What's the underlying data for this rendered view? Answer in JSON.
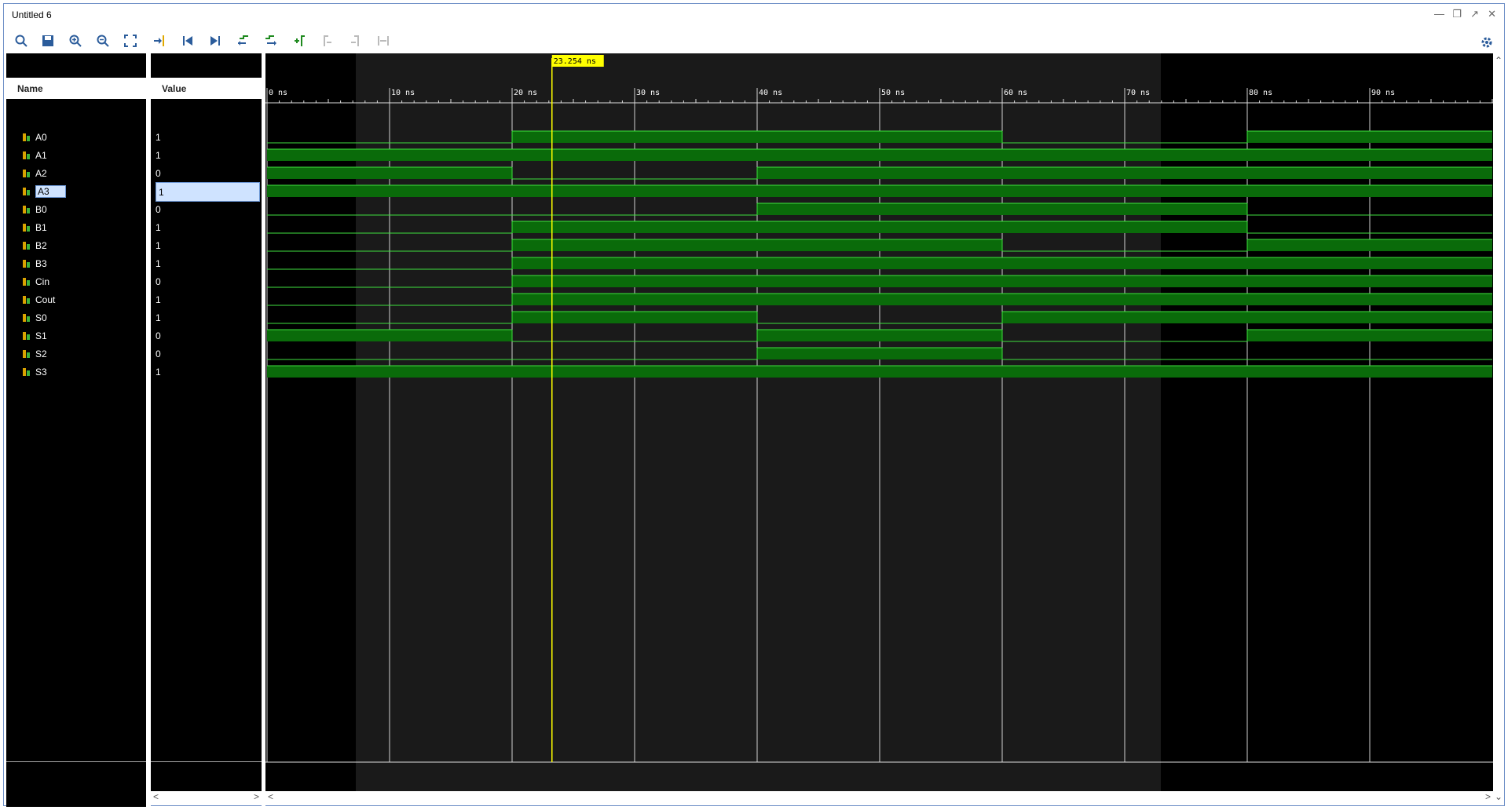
{
  "window": {
    "title": "Untitled 6"
  },
  "toolbar": {
    "icons": [
      "search-icon",
      "save-icon",
      "zoom-in-icon",
      "zoom-out-icon",
      "zoom-fit-icon",
      "go-to-cursor-icon",
      "go-to-time-zero-icon",
      "go-to-last-time-icon",
      "previous-transition-icon",
      "next-transition-icon",
      "add-marker-icon",
      "previous-marker-icon",
      "next-marker-icon",
      "swap-cursors-icon",
      "settings-icon"
    ]
  },
  "columns": {
    "name": "Name",
    "value": "Value"
  },
  "cursor": {
    "label": "23.254 ns",
    "time": 23.254
  },
  "time_axis": {
    "ticks": [
      "0 ns",
      "10 ns",
      "20 ns",
      "30 ns",
      "40 ns",
      "50 ns",
      "60 ns",
      "70 ns",
      "80 ns",
      "90 ns"
    ],
    "max": 100
  },
  "signals": [
    {
      "name": "A0",
      "value": "1",
      "segments": [
        [
          0,
          20,
          0
        ],
        [
          20,
          60,
          1
        ],
        [
          60,
          80,
          0
        ],
        [
          80,
          100,
          1
        ]
      ]
    },
    {
      "name": "A1",
      "value": "1",
      "segments": [
        [
          0,
          100,
          1
        ]
      ]
    },
    {
      "name": "A2",
      "value": "0",
      "segments": [
        [
          0,
          20,
          1
        ],
        [
          20,
          40,
          0
        ],
        [
          40,
          100,
          1
        ]
      ]
    },
    {
      "name": "A3",
      "value": "1",
      "selected": true,
      "segments": [
        [
          0,
          100,
          1
        ]
      ]
    },
    {
      "name": "B0",
      "value": "0",
      "segments": [
        [
          0,
          40,
          0
        ],
        [
          40,
          80,
          1
        ],
        [
          80,
          100,
          0
        ]
      ]
    },
    {
      "name": "B1",
      "value": "1",
      "segments": [
        [
          0,
          20,
          0
        ],
        [
          20,
          80,
          1
        ],
        [
          80,
          100,
          0
        ]
      ]
    },
    {
      "name": "B2",
      "value": "1",
      "segments": [
        [
          0,
          20,
          0
        ],
        [
          20,
          60,
          1
        ],
        [
          60,
          80,
          0
        ],
        [
          80,
          100,
          1
        ]
      ]
    },
    {
      "name": "B3",
      "value": "1",
      "segments": [
        [
          0,
          20,
          0
        ],
        [
          20,
          100,
          1
        ]
      ]
    },
    {
      "name": "Cin",
      "value": "0",
      "segments": [
        [
          0,
          20,
          0
        ],
        [
          20,
          100,
          1
        ]
      ]
    },
    {
      "name": "Cout",
      "value": "1",
      "segments": [
        [
          0,
          20,
          0
        ],
        [
          20,
          100,
          1
        ]
      ]
    },
    {
      "name": "S0",
      "value": "1",
      "segments": [
        [
          0,
          20,
          0
        ],
        [
          20,
          40,
          1
        ],
        [
          40,
          60,
          0
        ],
        [
          60,
          100,
          1
        ]
      ]
    },
    {
      "name": "S1",
      "value": "0",
      "segments": [
        [
          0,
          20,
          1
        ],
        [
          20,
          40,
          0
        ],
        [
          40,
          60,
          1
        ],
        [
          60,
          80,
          0
        ],
        [
          80,
          100,
          1
        ]
      ]
    },
    {
      "name": "S2",
      "value": "0",
      "segments": [
        [
          0,
          40,
          0
        ],
        [
          40,
          60,
          1
        ],
        [
          60,
          100,
          0
        ]
      ]
    },
    {
      "name": "S3",
      "value": "1",
      "segments": [
        [
          0,
          100,
          1
        ]
      ]
    }
  ],
  "colors": {
    "wave_high_fill": "#0a6b0a",
    "wave_line": "#3fe03f",
    "cursor": "#ffff00",
    "grid": "#d0d0d0",
    "accent": "#3c6fbd"
  }
}
